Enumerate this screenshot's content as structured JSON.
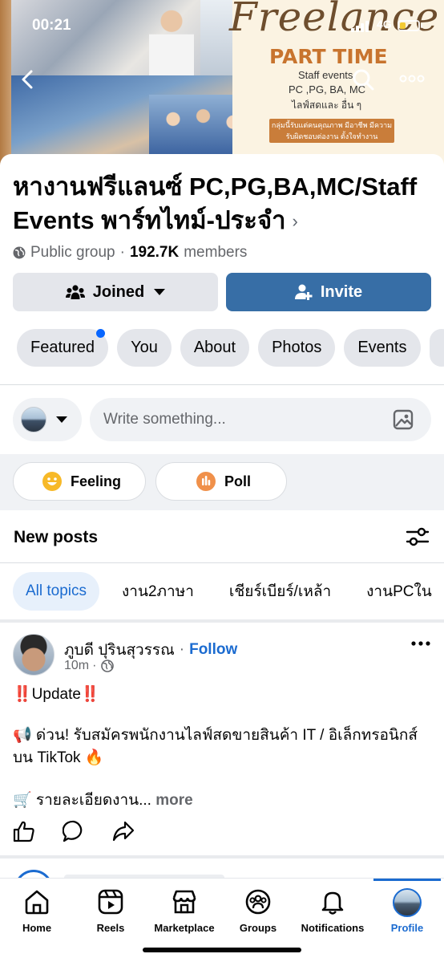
{
  "status_bar": {
    "time": "00:21",
    "network": "4G",
    "battery_level": 0.3
  },
  "cover": {
    "headline": "Freelance",
    "subheadline": "PART TIME",
    "lines": [
      "Staff events",
      "PC ,PG, BA, MC",
      "ไลฟ์สดและ อื่น ๆ"
    ],
    "tagline": "กลุ่มนี้รับแต่คนคุณภาพ มีอาชีพ มีความรับผิดชอบต่องาน ตั้งใจทำงาน"
  },
  "group": {
    "name": "หางานฟรีแลนซ์ PC,PG,BA,MC/Staff Events พาร์ทไทม์-ประจำ",
    "chevron": "›",
    "privacy": "Public group",
    "separator": "·",
    "member_count": "192.7K",
    "members_label": "members"
  },
  "buttons": {
    "joined": "Joined",
    "invite": "Invite"
  },
  "tabs": [
    {
      "label": "Featured",
      "has_dot": true
    },
    {
      "label": "You"
    },
    {
      "label": "About"
    },
    {
      "label": "Photos"
    },
    {
      "label": "Events"
    }
  ],
  "composer": {
    "placeholder": "Write something..."
  },
  "quick_actions": {
    "feeling": "Feeling",
    "poll": "Poll"
  },
  "new_posts": {
    "title": "New posts",
    "topics": [
      "All topics",
      "งาน2ภาษา",
      "เชียร์เบียร์/เหล้า",
      "งานPCใน"
    ]
  },
  "post": {
    "author": "ภูบดี ปุรินสุวรรณ",
    "separator": "·",
    "follow": "Follow",
    "time": "10m",
    "dot": "·",
    "line1": "‼️Update‼️",
    "line2": "📢 ด่วน! รับสมัครพนักงานไลฟ์สดขายสินค้า IT / อิเล็กทรอนิกส์",
    "line3": "บน TikTok 🔥",
    "line4": "🛒 รายละเอียดงาน...",
    "more": "more"
  },
  "nav": {
    "items": [
      "Home",
      "Reels",
      "Marketplace",
      "Groups",
      "Notifications",
      "Profile"
    ],
    "active": "Profile"
  },
  "colors": {
    "accent": "#1b6bd0",
    "invite_bg": "#376ea6",
    "chip_bg": "#e4e6eb"
  }
}
